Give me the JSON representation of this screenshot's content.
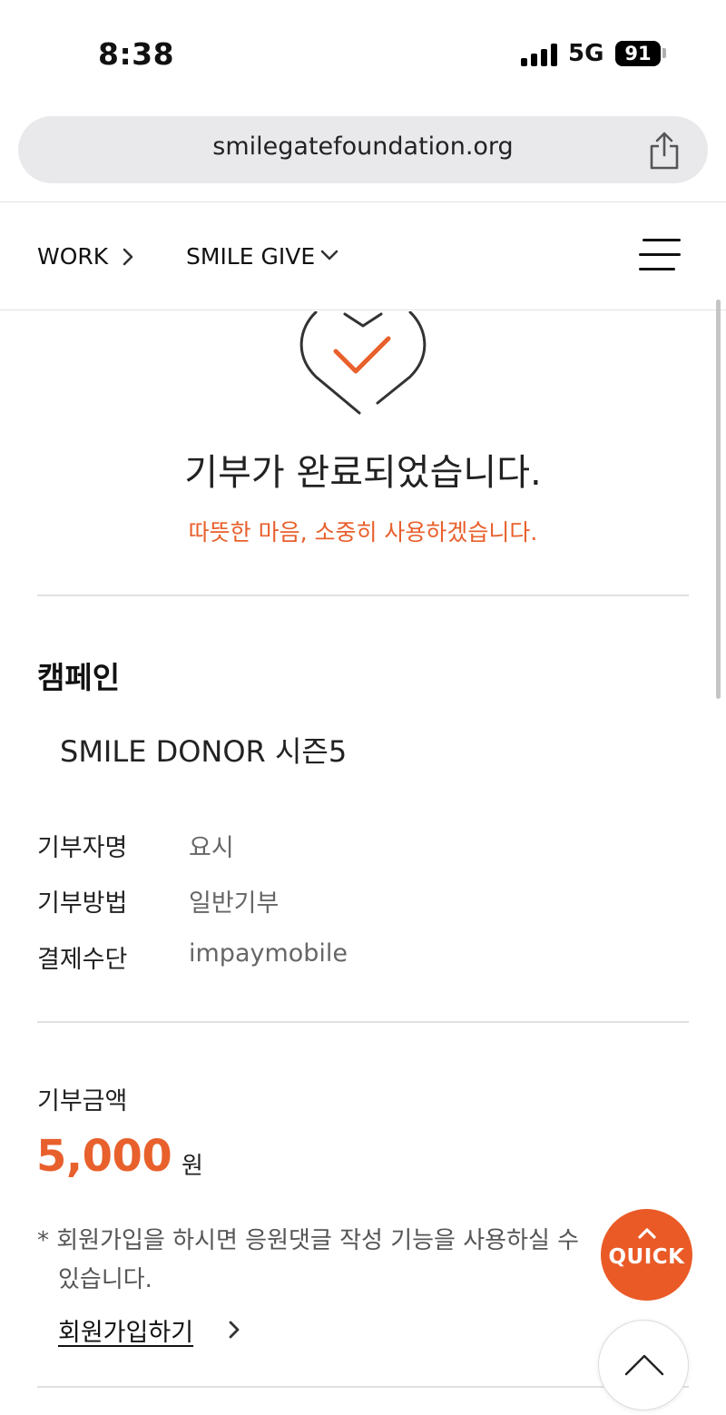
{
  "status_bar": {
    "time": "8:38",
    "network": "5G",
    "battery": "91"
  },
  "browser": {
    "url": "smilegatefoundation.org",
    "share_icon": "share-icon"
  },
  "nav": {
    "breadcrumb_1": "WORK",
    "breadcrumb_2": "SMILE GIVE",
    "menu_icon": "hamburger-menu-icon"
  },
  "completion": {
    "icon": "heart-check-icon",
    "title": "기부가 완료되었습니다.",
    "subtitle": "따뜻한 마음, 소중히 사용하겠습니다."
  },
  "campaign": {
    "label": "캠페인",
    "name": "SMILE DONOR 시즌5"
  },
  "details": [
    {
      "key": "기부자명",
      "value": "요시"
    },
    {
      "key": "기부방법",
      "value": "일반기부"
    },
    {
      "key": "결제수단",
      "value": "impaymobile"
    }
  ],
  "amount": {
    "label": "기부금액",
    "value": "5,000",
    "unit": "원"
  },
  "notice": {
    "line_1": "* 회원가입을 하시면 응원댓글 작성 기능을 사용하실 수",
    "line_2": "있습니다.",
    "signup_link": "회원가입하기"
  },
  "floating": {
    "quick_label": "QUICK",
    "top_icon": "chevron-up-icon"
  },
  "colors": {
    "accent": "#e8602c",
    "quick_button": "#ea5a26"
  }
}
